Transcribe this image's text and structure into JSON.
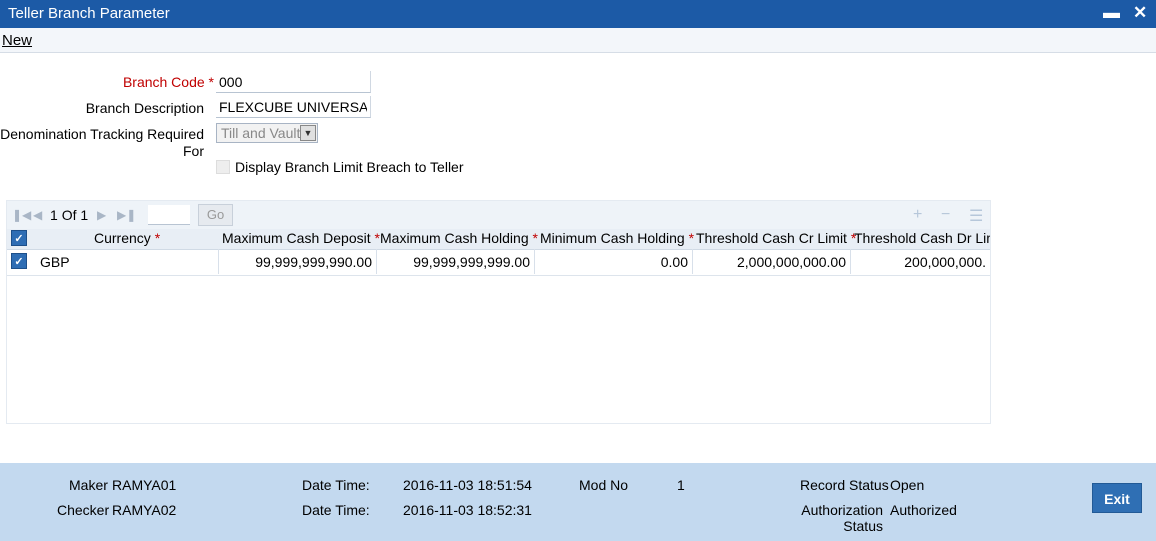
{
  "window": {
    "title": "Teller Branch Parameter"
  },
  "menu": {
    "new_label": "New"
  },
  "form": {
    "branch_code_label": "Branch Code",
    "branch_code_value": "000",
    "branch_desc_label": "Branch Description",
    "branch_desc_value": "FLEXCUBE UNIVERSAL I",
    "denom_label_line1": "Denomination Tracking Required",
    "denom_label_line2": "For",
    "denom_value": "Till and Vault",
    "display_limit_label": "Display Branch Limit Breach to Teller",
    "required_mark": "*"
  },
  "grid": {
    "page_current": "1",
    "page_of": "Of",
    "page_total": "1",
    "go_label": "Go",
    "columns": [
      {
        "label": "Currency",
        "required": true
      },
      {
        "label": "Maximum Cash Deposit",
        "required": true
      },
      {
        "label": "Maximum Cash Holding",
        "required": true
      },
      {
        "label": "Minimum Cash Holding",
        "required": true
      },
      {
        "label": "Threshold Cash Cr Limit",
        "required": true
      },
      {
        "label": "Threshold Cash Dr Limit",
        "required": false
      }
    ],
    "rows": [
      {
        "currency": "GBP",
        "max_deposit": "99,999,999,990.00",
        "max_holding": "99,999,999,999.00",
        "min_holding": "0.00",
        "cr_limit": "2,000,000,000.00",
        "dr_limit": "200,000,000."
      }
    ]
  },
  "footer": {
    "maker_label": "Maker",
    "maker_value": "RAMYA01",
    "checker_label": "Checker",
    "checker_value": "RAMYA02",
    "datetime_label": "Date Time:",
    "maker_datetime": "2016-11-03 18:51:54",
    "checker_datetime": "2016-11-03 18:52:31",
    "mod_no_label": "Mod No",
    "mod_no_value": "1",
    "record_status_label": "Record Status",
    "record_status_value": "Open",
    "auth_status_label_line1": "Authorization",
    "auth_status_label_line2": "Status",
    "auth_status_value": "Authorized",
    "exit_label": "Exit"
  },
  "colors": {
    "titlebar": "#1c5aa6",
    "footer": "#c3d9ef",
    "required": "#c00000",
    "accent_button": "#2f6fb4"
  },
  "icons": {
    "minimize": "minimize-icon",
    "close": "close-icon",
    "first": "first-page-icon",
    "prev": "prev-page-icon",
    "next": "next-page-icon",
    "last": "last-page-icon",
    "add": "add-row-icon",
    "delete": "delete-row-icon",
    "view": "single-view-icon"
  }
}
